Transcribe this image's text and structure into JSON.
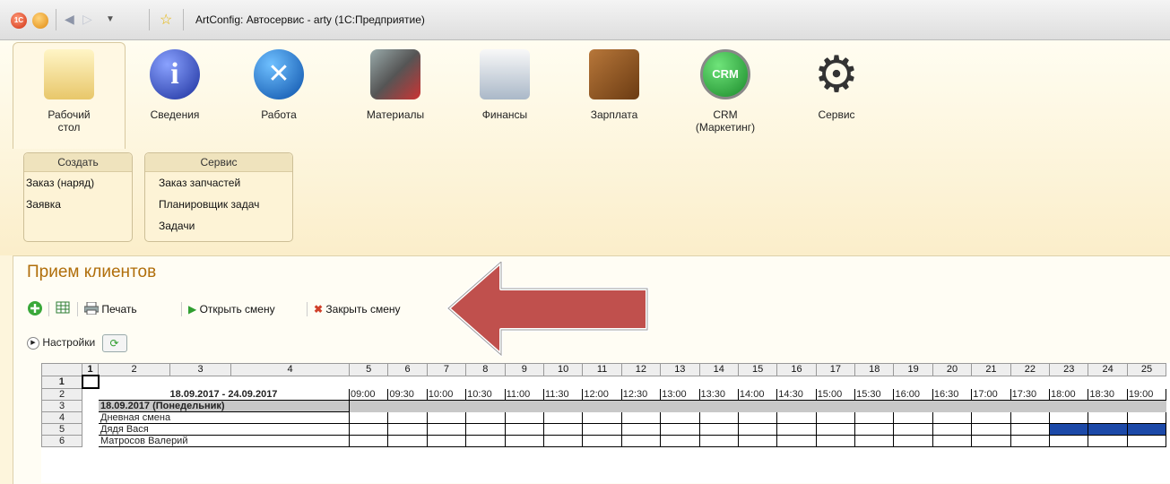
{
  "window": {
    "title": "ArtConfig: Автосервис - arty  (1С:Предприятие)"
  },
  "sections": [
    {
      "label": "Рабочий\nстол",
      "icon": "desk-lamp-icon"
    },
    {
      "label": "Сведения",
      "icon": "info-icon"
    },
    {
      "label": "Работа",
      "icon": "tools-icon"
    },
    {
      "label": "Материалы",
      "icon": "materials-icon"
    },
    {
      "label": "Финансы",
      "icon": "cash-register-icon"
    },
    {
      "label": "Зарплата",
      "icon": "wallet-icon"
    },
    {
      "label": "CRM\n(Маркетинг)",
      "icon": "crm-icon"
    },
    {
      "label": "Сервис",
      "icon": "gear-icon"
    }
  ],
  "crm_icon_text": "CRM",
  "groups": [
    {
      "header": "Создать",
      "items": [
        "Заказ (наряд)",
        "Заявка"
      ]
    },
    {
      "header": "Сервис",
      "items": [
        "Заказ запчастей",
        "Планировщик задач",
        "Задачи"
      ]
    }
  ],
  "form": {
    "title": "Прием клиентов"
  },
  "toolbar": {
    "print": "Печать",
    "open_shift": "Открыть смену",
    "close_shift": "Закрыть смену"
  },
  "settings": {
    "label": "Настройки"
  },
  "spreadsheet": {
    "column_headers": [
      "1",
      "2",
      "3",
      "4",
      "5",
      "6",
      "7",
      "8",
      "9",
      "10",
      "11",
      "12",
      "13",
      "14",
      "15",
      "16",
      "17",
      "18",
      "19",
      "20",
      "21",
      "22",
      "23",
      "24",
      "25"
    ],
    "row_numbers": [
      "1",
      "2",
      "3",
      "4",
      "5",
      "6"
    ],
    "date_range": "18.09.2017 - 24.09.2017",
    "times": [
      "09:00",
      "09:30",
      "10:00",
      "10:30",
      "11:00",
      "11:30",
      "12:00",
      "12:30",
      "13:00",
      "13:30",
      "14:00",
      "14:30",
      "15:00",
      "15:30",
      "16:00",
      "16:30",
      "17:00",
      "17:30",
      "18:00",
      "18:30",
      "19:00"
    ],
    "day_header": "18.09.2017 (Понедельник)",
    "rows": [
      "Дневная смена",
      "Дядя Вася",
      "Матросов Валерий"
    ],
    "booked_color": "#1c49a8",
    "booked_row": "Дядя Вася",
    "booked_times": [
      "18:00",
      "18:30",
      "19:00"
    ]
  },
  "colors": {
    "accent_title": "#b06e0a",
    "arrow": "#c0504d",
    "panel": "#fdf5dc"
  }
}
